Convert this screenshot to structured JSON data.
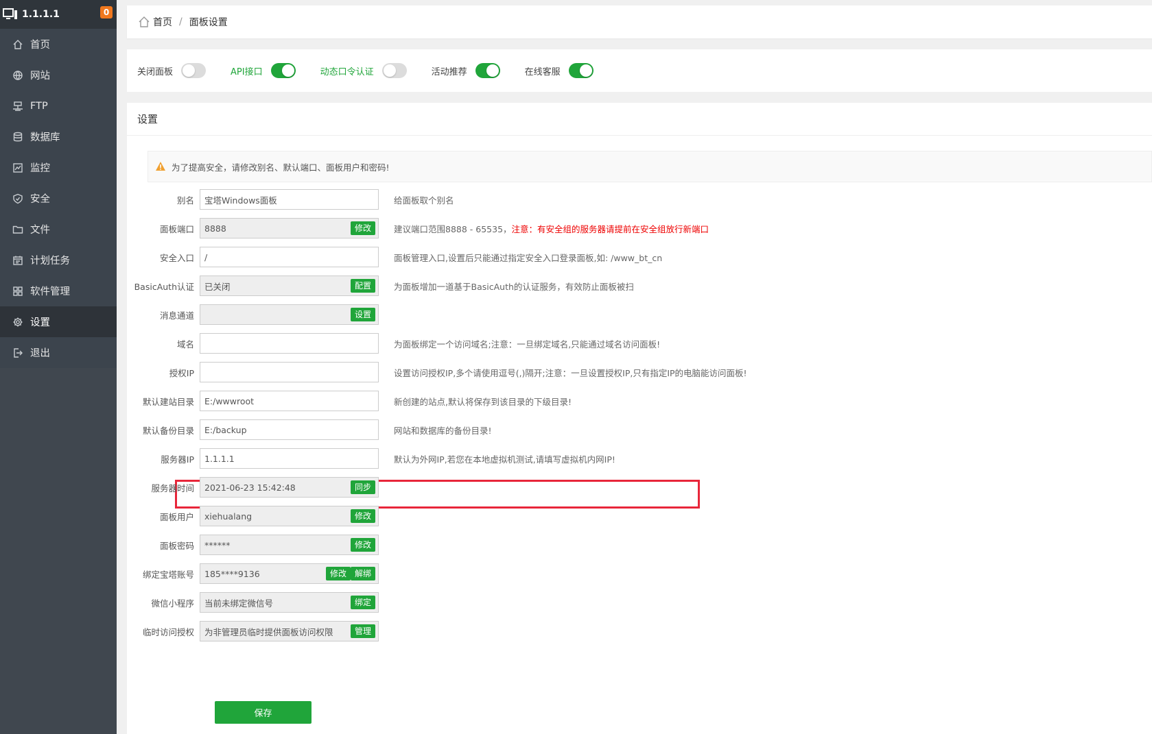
{
  "sidebar": {
    "ip": "1.1.1.1",
    "badge": "0",
    "items": [
      {
        "label": "首页",
        "icon": "home-icon"
      },
      {
        "label": "网站",
        "icon": "globe-icon"
      },
      {
        "label": "FTP",
        "icon": "ftp-icon"
      },
      {
        "label": "数据库",
        "icon": "database-icon"
      },
      {
        "label": "监控",
        "icon": "monitor-icon"
      },
      {
        "label": "安全",
        "icon": "shield-icon"
      },
      {
        "label": "文件",
        "icon": "folder-icon"
      },
      {
        "label": "计划任务",
        "icon": "calendar-icon"
      },
      {
        "label": "软件管理",
        "icon": "grid-icon"
      },
      {
        "label": "设置",
        "icon": "gear-icon"
      },
      {
        "label": "退出",
        "icon": "logout-icon"
      }
    ],
    "active_index": 9
  },
  "breadcrumb": {
    "home": "首页",
    "separator": "/",
    "current": "面板设置"
  },
  "toggles": [
    {
      "label": "关闭面板",
      "on": false,
      "label_green": false
    },
    {
      "label": "API接口",
      "on": true,
      "label_green": true
    },
    {
      "label": "动态口令认证",
      "on": false,
      "label_green": true
    },
    {
      "label": "活动推荐",
      "on": true,
      "label_green": false
    },
    {
      "label": "在线客服",
      "on": true,
      "label_green": false
    }
  ],
  "settings": {
    "title": "设置",
    "warning": "为了提高安全，请修改别名、默认端口、面板用户和密码!",
    "rows": [
      {
        "label": "别名",
        "value": "宝塔Windows面板",
        "readonly": false,
        "buttons": [],
        "hint": "给面板取个别名"
      },
      {
        "label": "面板端口",
        "value": "8888",
        "readonly": true,
        "buttons": [
          "修改"
        ],
        "hint": "建议端口范围8888 - 65535，",
        "hint_red": "注意：有安全组的服务器请提前在安全组放行新端口"
      },
      {
        "label": "安全入口",
        "value": "/",
        "readonly": false,
        "buttons": [],
        "hint": "面板管理入口,设置后只能通过指定安全入口登录面板,如: /www_bt_cn"
      },
      {
        "label": "BasicAuth认证",
        "value": "已关闭",
        "readonly": true,
        "buttons": [
          "配置"
        ],
        "hint": "为面板增加一道基于BasicAuth的认证服务，有效防止面板被扫"
      },
      {
        "label": "消息通道",
        "value": "",
        "readonly": true,
        "buttons": [
          "设置"
        ],
        "hint": ""
      },
      {
        "label": "域名",
        "value": "",
        "readonly": false,
        "buttons": [],
        "hint": "为面板绑定一个访问域名;注意：一旦绑定域名,只能通过域名访问面板!"
      },
      {
        "label": "授权IP",
        "value": "",
        "readonly": false,
        "buttons": [],
        "hint": "设置访问授权IP,多个请使用逗号(,)隔开;注意：一旦设置授权IP,只有指定IP的电脑能访问面板!"
      },
      {
        "label": "默认建站目录",
        "value": "E:/wwwroot",
        "readonly": false,
        "buttons": [],
        "hint": "新创建的站点,默认将保存到该目录的下级目录!"
      },
      {
        "label": "默认备份目录",
        "value": "E:/backup",
        "readonly": false,
        "buttons": [],
        "hint": "网站和数据库的备份目录!"
      },
      {
        "label": "服务器IP",
        "value": "1.1.1.1",
        "readonly": false,
        "buttons": [],
        "hint": "默认为外网IP,若您在本地虚拟机测试,请填写虚拟机内网IP!"
      },
      {
        "label": "服务器时间",
        "value": "2021-06-23 15:42:48",
        "readonly": true,
        "buttons": [
          "同步"
        ],
        "hint": ""
      },
      {
        "label": "面板用户",
        "value": "xiehualang",
        "readonly": true,
        "buttons": [
          "修改"
        ],
        "hint": ""
      },
      {
        "label": "面板密码",
        "value": "******",
        "readonly": true,
        "buttons": [
          "修改"
        ],
        "hint": ""
      },
      {
        "label": "绑定宝塔账号",
        "value": "185****9136",
        "readonly": true,
        "buttons": [
          "修改",
          "解绑"
        ],
        "hint": ""
      },
      {
        "label": "微信小程序",
        "value": "当前未绑定微信号",
        "readonly": true,
        "buttons": [
          "绑定"
        ],
        "hint": ""
      },
      {
        "label": "临时访问授权",
        "value": "为非管理员临时提供面板访问权限",
        "readonly": true,
        "buttons": [
          "管理"
        ],
        "hint": ""
      }
    ],
    "save_label": "保存"
  },
  "colors": {
    "accent_green": "#20a53a",
    "sidebar_bg": "#3c444d",
    "highlight_red": "#e8263a",
    "badge_orange": "#f0781e"
  }
}
